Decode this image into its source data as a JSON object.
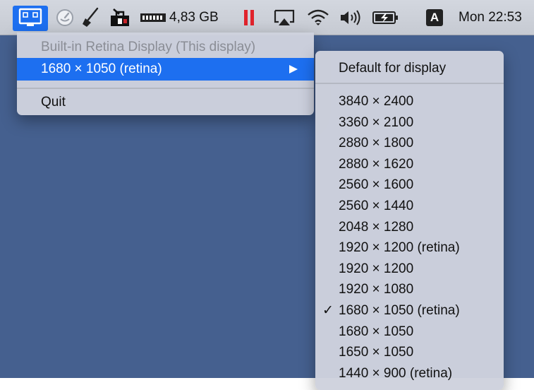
{
  "menubar": {
    "app_icon": "display-icon",
    "items": [
      {
        "name": "clock-app-icon"
      },
      {
        "name": "broom-icon"
      },
      {
        "name": "toolbox-icon"
      }
    ],
    "memory_label": "4,83 GB",
    "clock": "Mon 22:53",
    "input_source": "A",
    "accent_color": "#1d6ff0",
    "pause_color": "#e0232c"
  },
  "main_menu": {
    "header": "Built-in Retina Display (This display)",
    "current_resolution": "1680 × 1050 (retina)",
    "quit": "Quit"
  },
  "submenu": {
    "default_label": "Default for display",
    "resolutions": [
      {
        "label": "3840 × 2400"
      },
      {
        "label": "3360 × 2100"
      },
      {
        "label": "2880 × 1800"
      },
      {
        "label": "2880 × 1620"
      },
      {
        "label": "2560 × 1600"
      },
      {
        "label": "2560 × 1440"
      },
      {
        "label": "2048 × 1280"
      },
      {
        "label": "1920 × 1200 (retina)"
      },
      {
        "label": "1920 × 1200"
      },
      {
        "label": "1920 × 1080"
      },
      {
        "label": "1680 × 1050 (retina)",
        "checked": true
      },
      {
        "label": "1680 × 1050"
      },
      {
        "label": "1650 × 1050"
      },
      {
        "label": "1440 × 900 (retina)"
      }
    ],
    "checkmark": "✓"
  }
}
